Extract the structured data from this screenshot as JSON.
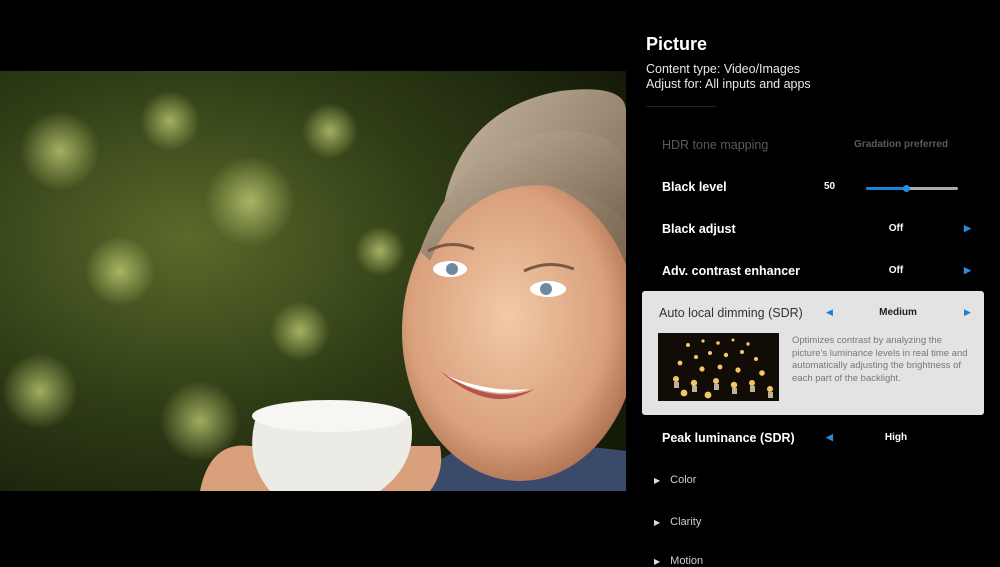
{
  "panel": {
    "title": "Picture",
    "content_type": "Content type: Video/Images",
    "adjust_for": "Adjust for: All inputs and apps"
  },
  "settings": {
    "hdr_tone_mapping": {
      "label": "HDR tone mapping",
      "value": "Gradation preferred"
    },
    "black_level": {
      "label": "Black level",
      "value": "50",
      "slider_fraction": 0.43
    },
    "black_adjust": {
      "label": "Black adjust",
      "value": "Off"
    },
    "adv_contrast": {
      "label": "Adv. contrast enhancer",
      "value": "Off"
    },
    "auto_local_dimming": {
      "label": "Auto local dimming (SDR)",
      "value": "Medium",
      "description": "Optimizes contrast by analyzing the picture's luminance levels in real time and automatically adjusting the brightness of each part of the backlight."
    },
    "peak_luminance": {
      "label": "Peak luminance (SDR)",
      "value": "High"
    }
  },
  "sections": {
    "color": "Color",
    "clarity": "Clarity",
    "motion": "Motion"
  },
  "icons": {
    "left_arrow": "caret-left-icon",
    "right_arrow": "caret-right-icon",
    "expand": "triangle-right-icon"
  },
  "colors": {
    "accent": "#1e7fd6",
    "panel_bg": "#000000",
    "card_bg": "#e3e3e3"
  }
}
